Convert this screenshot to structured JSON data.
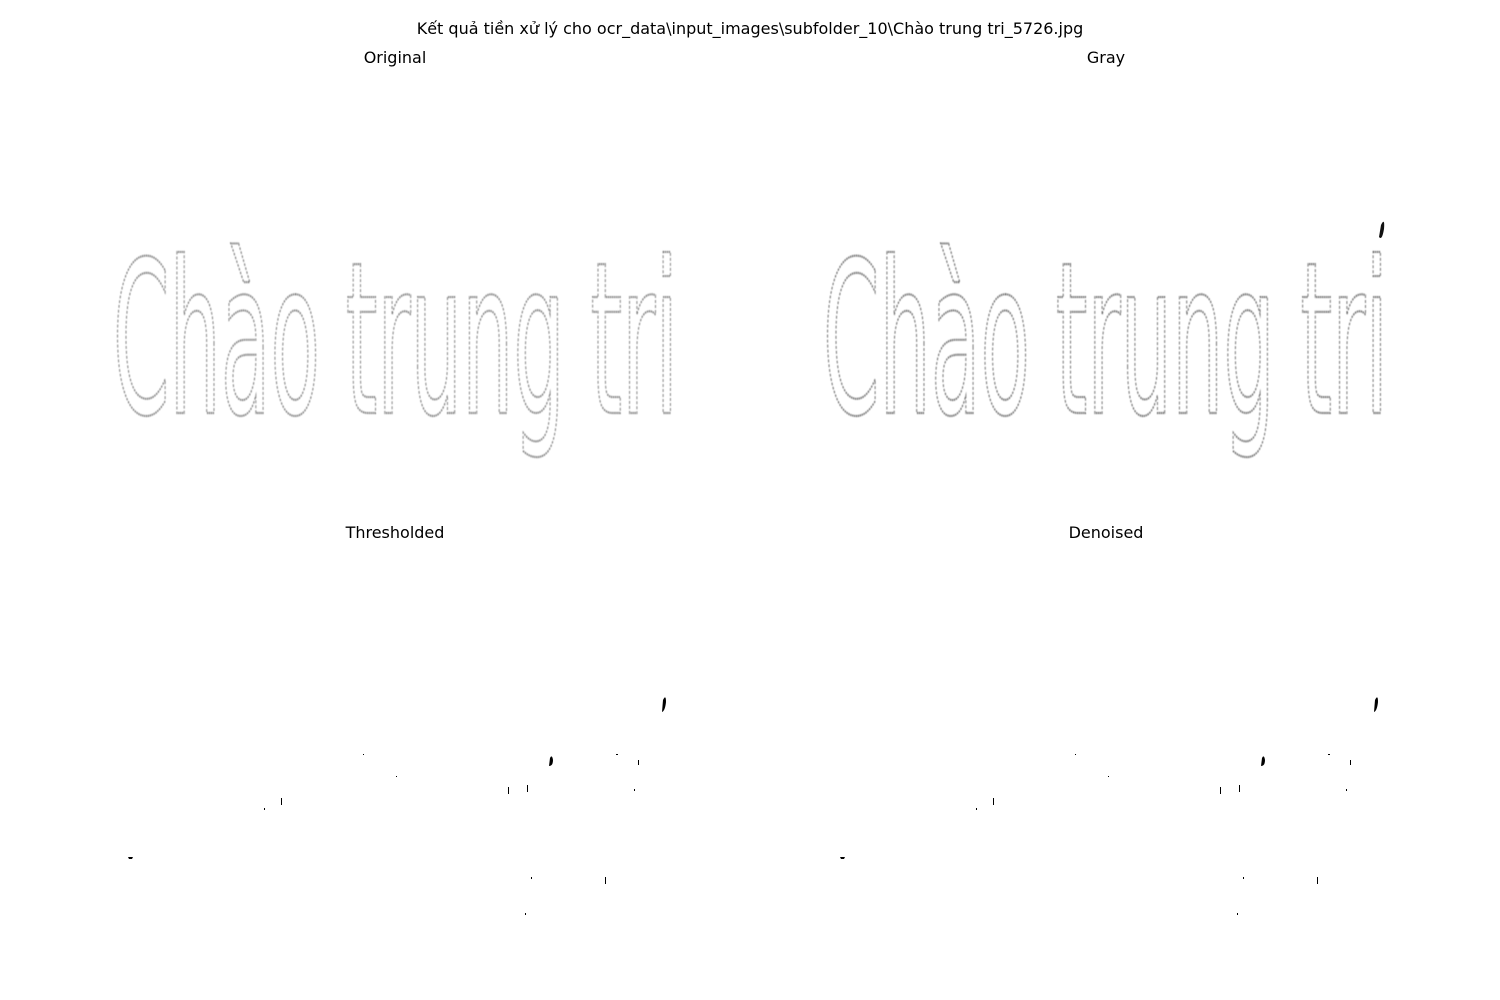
{
  "figure": {
    "title": "Kết quả tiền xử lý cho ocr_data\\input_images\\subfolder_10\\Chào trung tri_5726.jpg"
  },
  "panels": [
    {
      "title": "Original",
      "sample_text": "Chào trung tri"
    },
    {
      "title": "Gray",
      "sample_text": "Chào trung tri"
    },
    {
      "title": "Thresholded"
    },
    {
      "title": "Denoised"
    }
  ],
  "colors": {
    "background": "#ffffff",
    "ink": "#3a3a3a",
    "speck": "#000000"
  }
}
